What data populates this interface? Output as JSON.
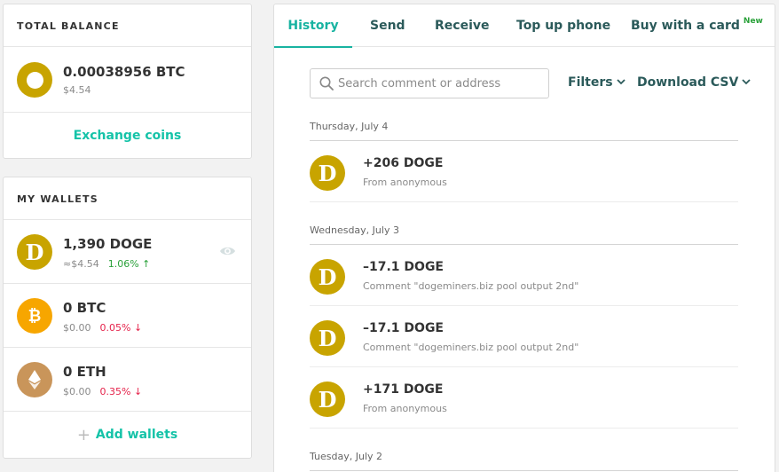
{
  "total_balance": {
    "title": "TOTAL BALANCE",
    "amount": "0.00038956 BTC",
    "fiat": "$4.54",
    "exchange_label": "Exchange coins"
  },
  "wallets": {
    "title": "MY WALLETS",
    "items": [
      {
        "amount": "1,390 DOGE",
        "fiat": "≈$4.54",
        "change": "1.06% ↑",
        "change_dir": "up",
        "icon": "doge-icon"
      },
      {
        "amount": "0 BTC",
        "fiat": "$0.00",
        "change": "0.05% ↓",
        "change_dir": "down",
        "icon": "btc-icon"
      },
      {
        "amount": "0 ETH",
        "fiat": "$0.00",
        "change": "0.35% ↓",
        "change_dir": "down",
        "icon": "eth-icon"
      }
    ],
    "add_label": "Add wallets"
  },
  "tabs": [
    {
      "label": "History",
      "active": true
    },
    {
      "label": "Send"
    },
    {
      "label": "Receive"
    },
    {
      "label": "Top up phone"
    },
    {
      "label": "Buy with a card",
      "badge": "New"
    }
  ],
  "search": {
    "placeholder": "Search comment or address",
    "value": ""
  },
  "filters_label": "Filters",
  "download_label": "Download CSV",
  "history": [
    {
      "date": "Thursday, July 4",
      "transactions": [
        {
          "amount": "+206 DOGE",
          "detail": "From anonymous"
        }
      ]
    },
    {
      "date": "Wednesday, July 3",
      "transactions": [
        {
          "amount": "–17.1 DOGE",
          "detail": "Comment \"dogeminers.biz pool output 2nd\""
        },
        {
          "amount": "–17.1 DOGE",
          "detail": "Comment \"dogeminers.biz pool output 2nd\""
        },
        {
          "amount": "+171 DOGE",
          "detail": "From anonymous"
        }
      ]
    },
    {
      "date": "Tuesday, July 2",
      "transactions": []
    }
  ],
  "colors": {
    "accent": "#18b3a1",
    "link": "#15c3a8",
    "doge": "#c8a400",
    "btc": "#f7a600",
    "eth": "#c9955a",
    "up": "#2aa13a",
    "down": "#e5234b",
    "new_badge": "#2aa13a"
  }
}
